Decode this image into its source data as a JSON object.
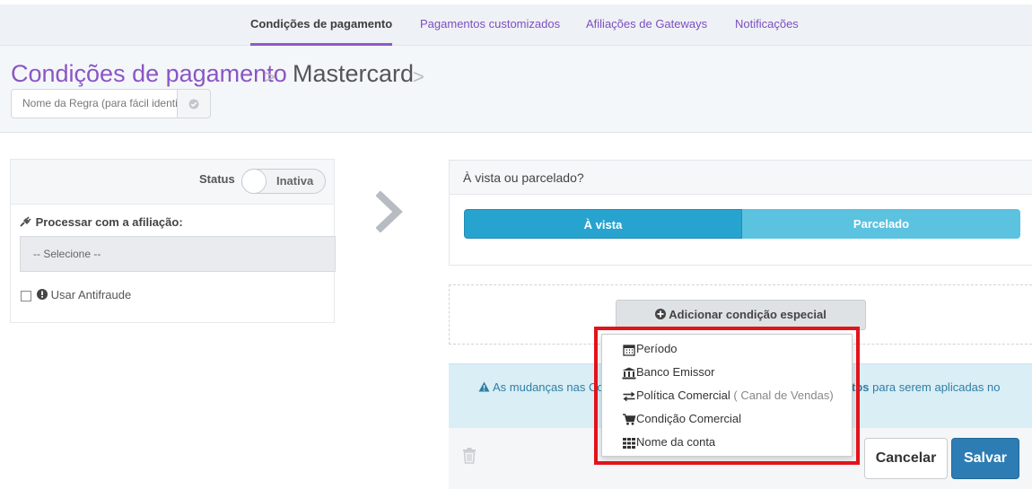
{
  "tabs": [
    {
      "label": "Condições de pagamento",
      "active": true
    },
    {
      "label": "Pagamentos customizados",
      "active": false
    },
    {
      "label": "Afiliações de Gateways",
      "active": false
    },
    {
      "label": "Notificações",
      "active": false
    }
  ],
  "breadcrumb": {
    "root": "Condições de pagamento",
    "current": "Mastercard",
    "separator": ">"
  },
  "rule_name": {
    "placeholder": "Nome da Regra (para fácil identificação)",
    "value": ""
  },
  "left_panel": {
    "status_label": "Status",
    "toggle_text": "Inativa",
    "process_label": "Processar com a afiliação:",
    "select_value": "-- Selecione --",
    "antifraude_label": "Usar Antifraude"
  },
  "right_panel": {
    "title": "À vista ou parcelado?",
    "option_cash": "À vista",
    "option_installments": "Parcelado"
  },
  "add_condition_label": "Adicionar condição especial",
  "alert": {
    "text_start": "As mudanças nas Co",
    "text_end": "tos para serem aplicadas no"
  },
  "footer": {
    "cancel_label": "Cancelar",
    "save_label": "Salvar"
  },
  "dropdown": {
    "items": [
      {
        "label": "Período",
        "icon": "calendar-icon"
      },
      {
        "label": "Banco Emissor",
        "icon": "bank-icon"
      },
      {
        "label": "Política Comercial",
        "hint": "( Canal de Vendas)",
        "icon": "exchange-icon"
      },
      {
        "label": "Condição Comercial",
        "icon": "cart-icon"
      },
      {
        "label": "Nome da conta",
        "icon": "grid-icon"
      }
    ]
  },
  "colors": {
    "brand": "#8a56c4",
    "primary": "#27a3cf",
    "save": "#2d7db4",
    "highlight": "#e3131b"
  }
}
